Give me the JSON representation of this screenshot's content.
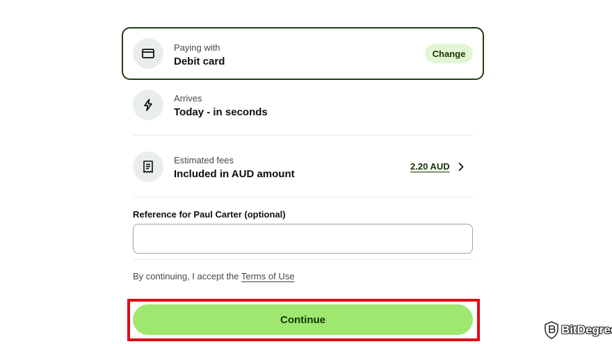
{
  "paying": {
    "label": "Paying with",
    "value": "Debit card",
    "change_label": "Change",
    "icon": "credit-card-icon"
  },
  "arrives": {
    "label": "Arrives",
    "value": "Today - in seconds",
    "icon": "lightning-icon"
  },
  "fees": {
    "label": "Estimated fees",
    "value": "Included in AUD amount",
    "amount": "2.20 AUD",
    "icon": "receipt-icon"
  },
  "reference": {
    "label": "Reference for Paul Carter (optional)",
    "value": "",
    "placeholder": ""
  },
  "terms": {
    "prefix": "By continuing, I accept the ",
    "link": "Terms of Use"
  },
  "continue_label": "Continue",
  "watermark": {
    "text": "BitDegree"
  },
  "colors": {
    "accent_green": "#9fe870",
    "dark_green": "#163300",
    "highlight_red": "#e30613"
  }
}
